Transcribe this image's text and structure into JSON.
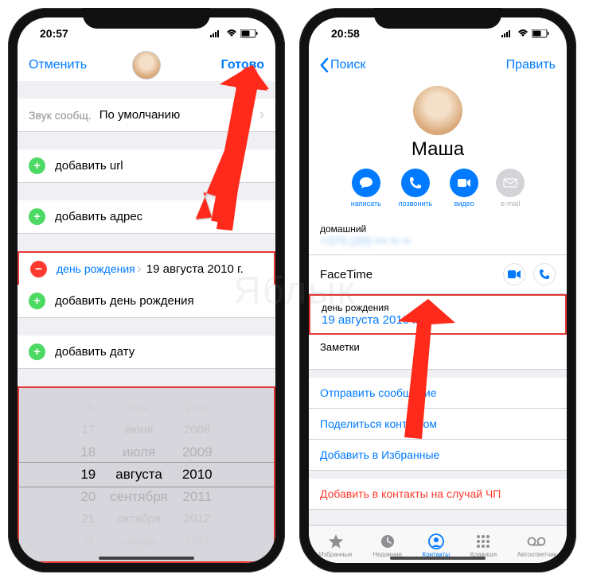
{
  "left": {
    "time": "20:57",
    "nav_cancel": "Отменить",
    "nav_done": "Готово",
    "sound_label": "Звук сообщ.",
    "sound_value": "По умолчанию",
    "add_url": "добавить url",
    "add_address": "добавить адрес",
    "bday_label": "день рождения",
    "bday_value": "19 августа 2010 г.",
    "add_bday": "добавить день рождения",
    "add_date": "добавить дату",
    "picker": {
      "days": [
        "16",
        "17",
        "18",
        "19",
        "20",
        "21",
        "22"
      ],
      "months": [
        "мая",
        "июня",
        "июля",
        "августа",
        "сентября",
        "октября",
        "ноября"
      ],
      "years": [
        "2007",
        "2008",
        "2009",
        "2010",
        "2011",
        "2012",
        "2013"
      ]
    }
  },
  "right": {
    "time": "20:58",
    "nav_back": "Поиск",
    "nav_edit": "Править",
    "contact_name": "Маша",
    "actions": {
      "message": "написать",
      "call": "позвонить",
      "video": "видео",
      "mail": "e-mail"
    },
    "phone_label": "домашний",
    "phone_value": "+375 (29) ••• •• ••",
    "facetime": "FaceTime",
    "bday_label": "день рождения",
    "bday_value": "19 августа 2010 г.",
    "notes": "Заметки",
    "send_message": "Отправить сообщение",
    "share_contact": "Поделиться контактом",
    "add_favorites": "Добавить в Избранные",
    "emergency": "Добавить в контакты на случай ЧП",
    "tabs": {
      "favorites": "Избранные",
      "recents": "Недавние",
      "contacts": "Контакты",
      "keypad": "Клавиши",
      "voicemail": "Автоответчик"
    }
  },
  "watermark": "Яблык"
}
